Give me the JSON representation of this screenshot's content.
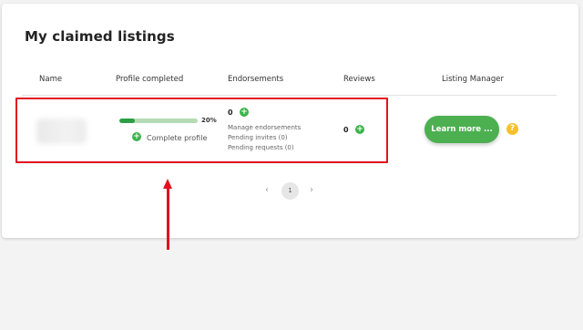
{
  "title": "My claimed listings",
  "columns": {
    "name": "Name",
    "profile": "Profile completed",
    "endorsements": "Endorsements",
    "reviews": "Reviews",
    "manager": "Listing Manager"
  },
  "row": {
    "profile_percent_label": "20%",
    "profile_progress": 0.2,
    "complete_profile": "Complete profile",
    "endorsements_count": "0",
    "manage_endorsements": "Manage endorsements",
    "pending_invites": "Pending invites (0)",
    "pending_requests": "Pending requests (0)",
    "reviews_count": "0",
    "learn_more": "Learn more ..."
  },
  "pagination": {
    "prev": "‹",
    "current": "1",
    "next": "›"
  },
  "icons": {
    "plus": "+",
    "help": "?"
  },
  "colors": {
    "accent_green": "#4caf50",
    "highlight_red": "#e3101e",
    "help_yellow": "#f6c12a"
  }
}
